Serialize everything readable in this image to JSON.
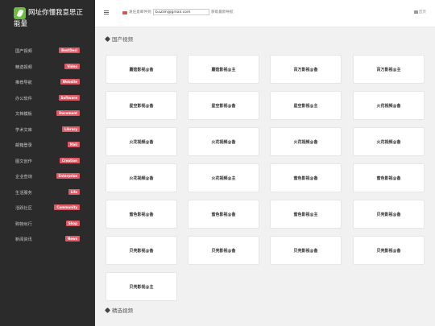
{
  "brand": {
    "line1": "网址你懂我意思正",
    "line2": "能量"
  },
  "sidebar": {
    "items": [
      {
        "label": "国产视频",
        "badge": "BestDesi"
      },
      {
        "label": "精选视频",
        "badge": "Video"
      },
      {
        "label": "推荐导航",
        "badge": "Website"
      },
      {
        "label": "办公软件",
        "badge": "Software"
      },
      {
        "label": "文档模板",
        "badge": "Document"
      },
      {
        "label": "学术文库",
        "badge": "Library"
      },
      {
        "label": "邮箱登录",
        "badge": "Mail"
      },
      {
        "label": "图文创作",
        "badge": "Creation"
      },
      {
        "label": "企业查询",
        "badge": "Enterprise"
      },
      {
        "label": "生活服务",
        "badge": "Life"
      },
      {
        "label": "活跃社区",
        "badge": "Community"
      },
      {
        "label": "购物出行",
        "badge": "Shop"
      },
      {
        "label": "新闻资讯",
        "badge": "News"
      }
    ]
  },
  "topbar": {
    "submit_label": "发任意邮件到",
    "email_value": "b3Z0n@gmail.com",
    "notice": "获取最新导航",
    "home": "首页"
  },
  "sections": [
    {
      "title": "国产视频",
      "cards": [
        "蘑菇影视@备",
        "蘑菇影视@主",
        "百万影视@备",
        "百万影视@主",
        "星空影视@备",
        "星空影视@备",
        "星空影视@主",
        "火花视频@备",
        "火花视频@备",
        "火花视频@备",
        "火花视频@备",
        "火花视频@备",
        "火花视频@备",
        "火花视频@主",
        "蜜色影视@备",
        "蜜色影视@备",
        "蜜色影视@备",
        "蜜色影视@备",
        "蜜色影视@主",
        "贝壳影视@备",
        "贝壳影视@备",
        "贝壳影视@备",
        "贝壳影视@备",
        "贝壳影视@备",
        "贝壳影视@主"
      ]
    },
    {
      "title": "精选视频"
    }
  ]
}
